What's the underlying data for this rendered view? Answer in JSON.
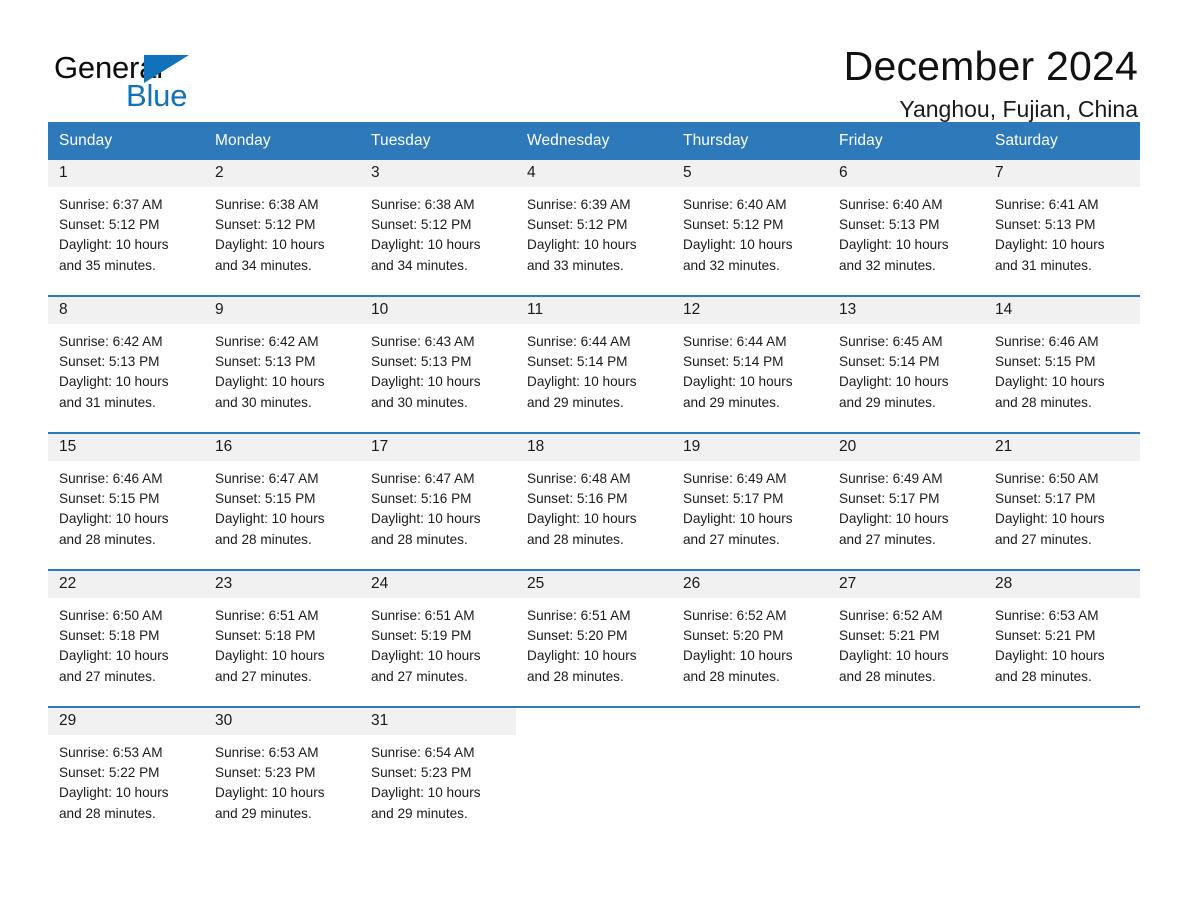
{
  "brand": {
    "name_part1": "General",
    "name_part2": "Blue",
    "accent_color": "#1072ba",
    "triangle_icon": "triangle-icon"
  },
  "header": {
    "title": "December 2024",
    "location": "Yanghou, Fujian, China"
  },
  "calendar": {
    "header_bg": "#2d79b9",
    "daynum_band_bg": "#f1f1f1",
    "weekdays": [
      "Sunday",
      "Monday",
      "Tuesday",
      "Wednesday",
      "Thursday",
      "Friday",
      "Saturday"
    ],
    "weeks": [
      [
        {
          "day": "1",
          "sunrise": "Sunrise: 6:37 AM",
          "sunset": "Sunset: 5:12 PM",
          "daylight_line1": "Daylight: 10 hours",
          "daylight_line2": "and 35 minutes."
        },
        {
          "day": "2",
          "sunrise": "Sunrise: 6:38 AM",
          "sunset": "Sunset: 5:12 PM",
          "daylight_line1": "Daylight: 10 hours",
          "daylight_line2": "and 34 minutes."
        },
        {
          "day": "3",
          "sunrise": "Sunrise: 6:38 AM",
          "sunset": "Sunset: 5:12 PM",
          "daylight_line1": "Daylight: 10 hours",
          "daylight_line2": "and 34 minutes."
        },
        {
          "day": "4",
          "sunrise": "Sunrise: 6:39 AM",
          "sunset": "Sunset: 5:12 PM",
          "daylight_line1": "Daylight: 10 hours",
          "daylight_line2": "and 33 minutes."
        },
        {
          "day": "5",
          "sunrise": "Sunrise: 6:40 AM",
          "sunset": "Sunset: 5:12 PM",
          "daylight_line1": "Daylight: 10 hours",
          "daylight_line2": "and 32 minutes."
        },
        {
          "day": "6",
          "sunrise": "Sunrise: 6:40 AM",
          "sunset": "Sunset: 5:13 PM",
          "daylight_line1": "Daylight: 10 hours",
          "daylight_line2": "and 32 minutes."
        },
        {
          "day": "7",
          "sunrise": "Sunrise: 6:41 AM",
          "sunset": "Sunset: 5:13 PM",
          "daylight_line1": "Daylight: 10 hours",
          "daylight_line2": "and 31 minutes."
        }
      ],
      [
        {
          "day": "8",
          "sunrise": "Sunrise: 6:42 AM",
          "sunset": "Sunset: 5:13 PM",
          "daylight_line1": "Daylight: 10 hours",
          "daylight_line2": "and 31 minutes."
        },
        {
          "day": "9",
          "sunrise": "Sunrise: 6:42 AM",
          "sunset": "Sunset: 5:13 PM",
          "daylight_line1": "Daylight: 10 hours",
          "daylight_line2": "and 30 minutes."
        },
        {
          "day": "10",
          "sunrise": "Sunrise: 6:43 AM",
          "sunset": "Sunset: 5:13 PM",
          "daylight_line1": "Daylight: 10 hours",
          "daylight_line2": "and 30 minutes."
        },
        {
          "day": "11",
          "sunrise": "Sunrise: 6:44 AM",
          "sunset": "Sunset: 5:14 PM",
          "daylight_line1": "Daylight: 10 hours",
          "daylight_line2": "and 29 minutes."
        },
        {
          "day": "12",
          "sunrise": "Sunrise: 6:44 AM",
          "sunset": "Sunset: 5:14 PM",
          "daylight_line1": "Daylight: 10 hours",
          "daylight_line2": "and 29 minutes."
        },
        {
          "day": "13",
          "sunrise": "Sunrise: 6:45 AM",
          "sunset": "Sunset: 5:14 PM",
          "daylight_line1": "Daylight: 10 hours",
          "daylight_line2": "and 29 minutes."
        },
        {
          "day": "14",
          "sunrise": "Sunrise: 6:46 AM",
          "sunset": "Sunset: 5:15 PM",
          "daylight_line1": "Daylight: 10 hours",
          "daylight_line2": "and 28 minutes."
        }
      ],
      [
        {
          "day": "15",
          "sunrise": "Sunrise: 6:46 AM",
          "sunset": "Sunset: 5:15 PM",
          "daylight_line1": "Daylight: 10 hours",
          "daylight_line2": "and 28 minutes."
        },
        {
          "day": "16",
          "sunrise": "Sunrise: 6:47 AM",
          "sunset": "Sunset: 5:15 PM",
          "daylight_line1": "Daylight: 10 hours",
          "daylight_line2": "and 28 minutes."
        },
        {
          "day": "17",
          "sunrise": "Sunrise: 6:47 AM",
          "sunset": "Sunset: 5:16 PM",
          "daylight_line1": "Daylight: 10 hours",
          "daylight_line2": "and 28 minutes."
        },
        {
          "day": "18",
          "sunrise": "Sunrise: 6:48 AM",
          "sunset": "Sunset: 5:16 PM",
          "daylight_line1": "Daylight: 10 hours",
          "daylight_line2": "and 28 minutes."
        },
        {
          "day": "19",
          "sunrise": "Sunrise: 6:49 AM",
          "sunset": "Sunset: 5:17 PM",
          "daylight_line1": "Daylight: 10 hours",
          "daylight_line2": "and 27 minutes."
        },
        {
          "day": "20",
          "sunrise": "Sunrise: 6:49 AM",
          "sunset": "Sunset: 5:17 PM",
          "daylight_line1": "Daylight: 10 hours",
          "daylight_line2": "and 27 minutes."
        },
        {
          "day": "21",
          "sunrise": "Sunrise: 6:50 AM",
          "sunset": "Sunset: 5:17 PM",
          "daylight_line1": "Daylight: 10 hours",
          "daylight_line2": "and 27 minutes."
        }
      ],
      [
        {
          "day": "22",
          "sunrise": "Sunrise: 6:50 AM",
          "sunset": "Sunset: 5:18 PM",
          "daylight_line1": "Daylight: 10 hours",
          "daylight_line2": "and 27 minutes."
        },
        {
          "day": "23",
          "sunrise": "Sunrise: 6:51 AM",
          "sunset": "Sunset: 5:18 PM",
          "daylight_line1": "Daylight: 10 hours",
          "daylight_line2": "and 27 minutes."
        },
        {
          "day": "24",
          "sunrise": "Sunrise: 6:51 AM",
          "sunset": "Sunset: 5:19 PM",
          "daylight_line1": "Daylight: 10 hours",
          "daylight_line2": "and 27 minutes."
        },
        {
          "day": "25",
          "sunrise": "Sunrise: 6:51 AM",
          "sunset": "Sunset: 5:20 PM",
          "daylight_line1": "Daylight: 10 hours",
          "daylight_line2": "and 28 minutes."
        },
        {
          "day": "26",
          "sunrise": "Sunrise: 6:52 AM",
          "sunset": "Sunset: 5:20 PM",
          "daylight_line1": "Daylight: 10 hours",
          "daylight_line2": "and 28 minutes."
        },
        {
          "day": "27",
          "sunrise": "Sunrise: 6:52 AM",
          "sunset": "Sunset: 5:21 PM",
          "daylight_line1": "Daylight: 10 hours",
          "daylight_line2": "and 28 minutes."
        },
        {
          "day": "28",
          "sunrise": "Sunrise: 6:53 AM",
          "sunset": "Sunset: 5:21 PM",
          "daylight_line1": "Daylight: 10 hours",
          "daylight_line2": "and 28 minutes."
        }
      ],
      [
        {
          "day": "29",
          "sunrise": "Sunrise: 6:53 AM",
          "sunset": "Sunset: 5:22 PM",
          "daylight_line1": "Daylight: 10 hours",
          "daylight_line2": "and 28 minutes."
        },
        {
          "day": "30",
          "sunrise": "Sunrise: 6:53 AM",
          "sunset": "Sunset: 5:23 PM",
          "daylight_line1": "Daylight: 10 hours",
          "daylight_line2": "and 29 minutes."
        },
        {
          "day": "31",
          "sunrise": "Sunrise: 6:54 AM",
          "sunset": "Sunset: 5:23 PM",
          "daylight_line1": "Daylight: 10 hours",
          "daylight_line2": "and 29 minutes."
        },
        {
          "day": "",
          "sunrise": "",
          "sunset": "",
          "daylight_line1": "",
          "daylight_line2": ""
        },
        {
          "day": "",
          "sunrise": "",
          "sunset": "",
          "daylight_line1": "",
          "daylight_line2": ""
        },
        {
          "day": "",
          "sunrise": "",
          "sunset": "",
          "daylight_line1": "",
          "daylight_line2": ""
        },
        {
          "day": "",
          "sunrise": "",
          "sunset": "",
          "daylight_line1": "",
          "daylight_line2": ""
        }
      ]
    ]
  }
}
